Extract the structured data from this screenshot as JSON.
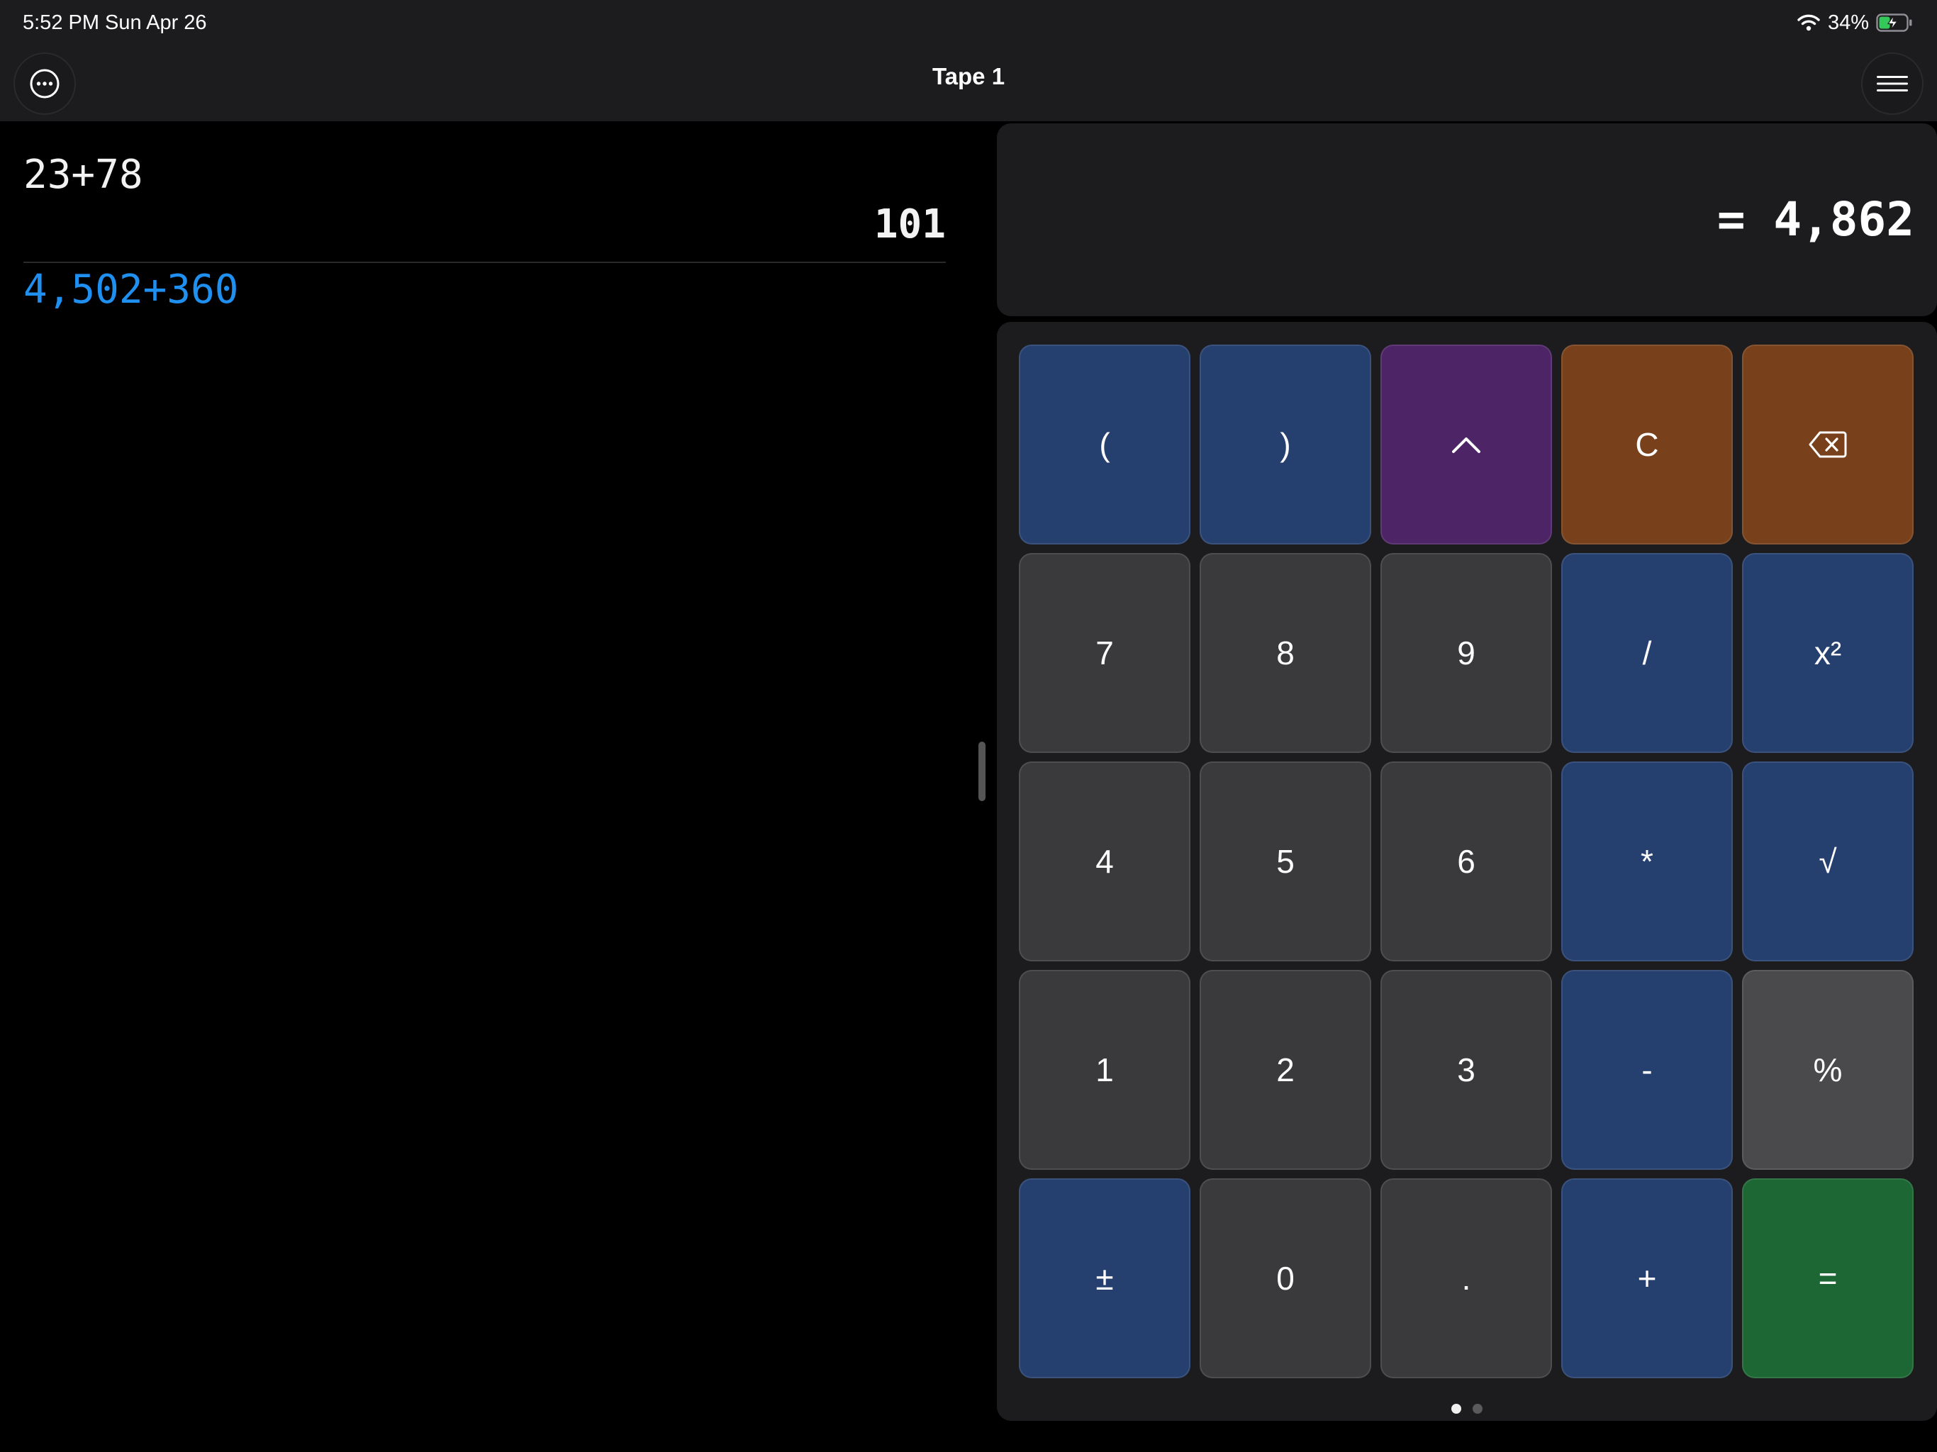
{
  "status_bar": {
    "time": "5:52 PM   Sun Apr 26",
    "battery": "34%"
  },
  "nav": {
    "title": "Tape 1"
  },
  "tape": {
    "entries": [
      {
        "expression": "23+78",
        "result": "101"
      }
    ],
    "current_expression": "4,502+360"
  },
  "display": {
    "value": "= 4,862"
  },
  "keypad": {
    "keys": [
      {
        "label": "(",
        "name": "open-paren-key",
        "style": "blue"
      },
      {
        "label": ")",
        "name": "close-paren-key",
        "style": "blue"
      },
      {
        "label": "",
        "name": "power-key",
        "style": "purple",
        "icon": "caret-up-icon"
      },
      {
        "label": "C",
        "name": "clear-key",
        "style": "orange"
      },
      {
        "label": "",
        "name": "backspace-key",
        "style": "orange",
        "icon": "backspace-icon"
      },
      {
        "label": "7",
        "name": "digit-7-key",
        "style": "gray"
      },
      {
        "label": "8",
        "name": "digit-8-key",
        "style": "gray"
      },
      {
        "label": "9",
        "name": "digit-9-key",
        "style": "gray"
      },
      {
        "label": "/",
        "name": "divide-key",
        "style": "blue"
      },
      {
        "label": "x²",
        "name": "square-key",
        "style": "blue"
      },
      {
        "label": "4",
        "name": "digit-4-key",
        "style": "gray"
      },
      {
        "label": "5",
        "name": "digit-5-key",
        "style": "gray"
      },
      {
        "label": "6",
        "name": "digit-6-key",
        "style": "gray"
      },
      {
        "label": "*",
        "name": "multiply-key",
        "style": "blue"
      },
      {
        "label": "√",
        "name": "square-root-key",
        "style": "blue"
      },
      {
        "label": "1",
        "name": "digit-1-key",
        "style": "gray"
      },
      {
        "label": "2",
        "name": "digit-2-key",
        "style": "gray"
      },
      {
        "label": "3",
        "name": "digit-3-key",
        "style": "gray"
      },
      {
        "label": "-",
        "name": "subtract-key",
        "style": "blue"
      },
      {
        "label": "%",
        "name": "percent-key",
        "style": "lgray"
      },
      {
        "label": "±",
        "name": "plus-minus-key",
        "style": "blue"
      },
      {
        "label": "0",
        "name": "digit-0-key",
        "style": "gray"
      },
      {
        "label": ".",
        "name": "decimal-key",
        "style": "gray"
      },
      {
        "label": "+",
        "name": "add-key",
        "style": "blue"
      },
      {
        "label": "=",
        "name": "equals-key",
        "style": "green"
      }
    ]
  },
  "pager": {
    "page_count": 2,
    "active_page": 1
  },
  "colors": {
    "tape_current": "#1f8ff0",
    "key_gray": "#3a3a3c",
    "key_light_gray": "#4a4a4c",
    "key_blue": "#253f6e",
    "key_purple": "#4d2466",
    "key_orange": "#78411b",
    "key_green": "#1d6734",
    "battery_charging": "#34c759"
  }
}
